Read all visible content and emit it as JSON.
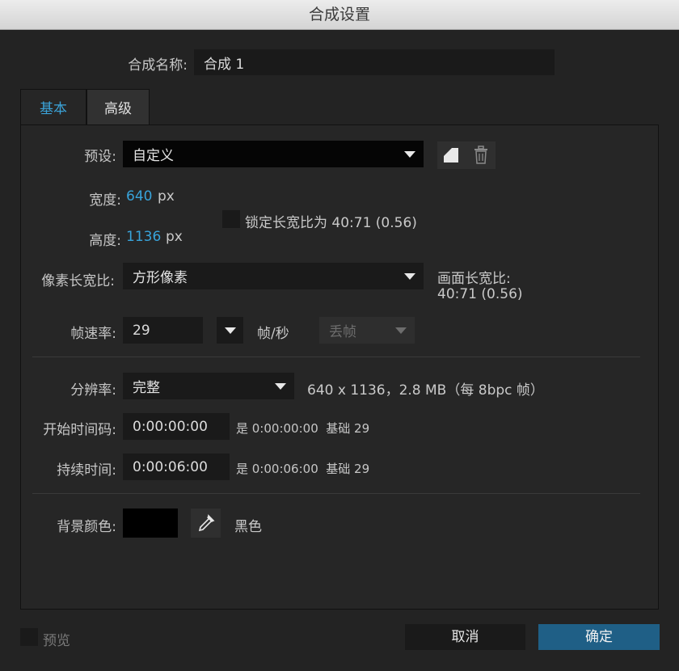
{
  "window": {
    "title": "合成设置"
  },
  "comp_name": {
    "label": "合成名称:",
    "value": "合成 1"
  },
  "tabs": [
    {
      "label": "基本"
    },
    {
      "label": "高级"
    }
  ],
  "preset": {
    "label": "预设:",
    "value": "自定义"
  },
  "width": {
    "label": "宽度:",
    "value": "640",
    "unit": "px"
  },
  "height": {
    "label": "高度:",
    "value": "1136",
    "unit": "px"
  },
  "lock_aspect": {
    "label": "锁定长宽比为 40:71 (0.56)",
    "checked": false
  },
  "pixel_aspect": {
    "label": "像素长宽比:",
    "value": "方形像素"
  },
  "frame_aspect": {
    "label": "画面长宽比:",
    "value": "40:71 (0.56)"
  },
  "frame_rate": {
    "label": "帧速率:",
    "value": "29",
    "unit": "帧/秒",
    "drop_frame": "丢帧"
  },
  "resolution": {
    "label": "分辨率:",
    "value": "完整",
    "info": "640 x 1136，2.8 MB（每 8bpc 帧）"
  },
  "start_timecode": {
    "label": "开始时间码:",
    "value": "0:00:00:00",
    "info": "是 0:00:00:00  基础 29"
  },
  "duration": {
    "label": "持续时间:",
    "value": "0:00:06:00",
    "info": "是 0:00:06:00  基础 29"
  },
  "background": {
    "label": "背景颜色:",
    "color_name": "黑色",
    "color": "#000000"
  },
  "footer": {
    "preview_label": "预览",
    "cancel_label": "取消",
    "ok_label": "确定"
  },
  "colors": {
    "accent": "#38a3da",
    "ok_button": "#1f5f86"
  }
}
